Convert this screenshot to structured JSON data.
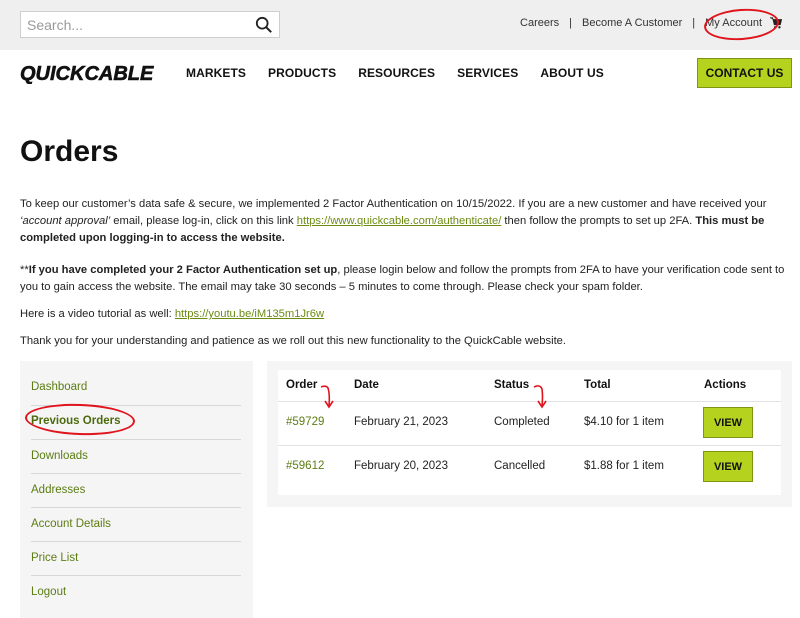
{
  "topbar": {
    "search_placeholder": "Search...",
    "links": [
      "Careers",
      "Become A Customer",
      "My Account"
    ],
    "separator": "|"
  },
  "brand": {
    "logo_text": "QUICKCABLE",
    "accent_color": "#b4d21e",
    "link_color": "#5c7d14",
    "annotation_color": "#e0141c"
  },
  "nav": {
    "items": [
      "MARKETS",
      "PRODUCTS",
      "RESOURCES",
      "SERVICES",
      "ABOUT US"
    ],
    "contact_label": "CONTACT US"
  },
  "page": {
    "title": "Orders",
    "p1_a": "To keep our customer’s data safe & secure, we implemented 2 Factor Authentication on 10/15/2022.  If you are a new customer and have received your ",
    "p1_em": "‘account approval’",
    "p1_b": " email, please log-in, click on this link ",
    "p1_link": "https://www.quickcable.com/authenticate/",
    "p1_c": " then follow the prompts to set up 2FA. ",
    "p1_strong": "This must be completed upon logging-in to access the website.",
    "p2_a": "**",
    "p2_strong": "If you have completed your 2 Factor Authentication set up",
    "p2_b": ", please login below and follow the prompts from 2FA to have your verification code sent to you to gain access the website. The email may take 30 seconds – 5 minutes to come through. Please check your spam folder.",
    "p3_a": "Here is a video tutorial as well: ",
    "p3_link": "https://youtu.be/iM135m1Jr6w",
    "p4": "Thank you for your understanding and patience as we roll out this new functionality to the QuickCable website."
  },
  "sidebar": {
    "items": [
      "Dashboard",
      "Previous Orders",
      "Downloads",
      "Addresses",
      "Account Details",
      "Price List",
      "Logout"
    ],
    "active": "Previous Orders"
  },
  "orders": {
    "headers": [
      "Order",
      "Date",
      "Status",
      "Total",
      "Actions"
    ],
    "rows": [
      {
        "order": "#59729",
        "date": "February 21, 2023",
        "status": "Completed",
        "total": "$4.10 for 1 item",
        "action": "VIEW"
      },
      {
        "order": "#59612",
        "date": "February 20, 2023",
        "status": "Cancelled",
        "total": "$1.88 for 1 item",
        "action": "VIEW"
      }
    ]
  }
}
